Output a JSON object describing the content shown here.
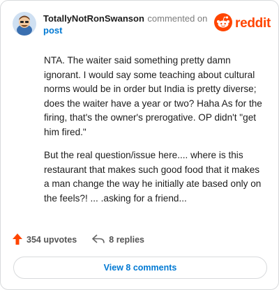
{
  "header": {
    "username": "TotallyNotRonSwanson",
    "commented_text": "commented on",
    "post_link": "post",
    "brand": "reddit"
  },
  "comment": {
    "paragraphs": [
      "NTA. The waiter said something pretty damn ignorant. I would say some teaching about cultural norms would be in order but India is pretty diverse; does the waiter have a year or two? Haha As for the firing, that's the owner's prerogative. OP didn't \"get him fired.\"",
      "But the real question/issue here.... where is this restaurant that makes such good food that it makes a man change the way he initially ate based only on the feels?! ... .asking for a friend..."
    ]
  },
  "actions": {
    "upvotes": "354 upvotes",
    "replies": "8 replies"
  },
  "footer": {
    "view_comments": "View 8 comments"
  },
  "colors": {
    "brand": "#ff4500",
    "link": "#0079d3",
    "upvote": "#ff4500"
  },
  "icons": {
    "avatar": "avatar",
    "logo": "reddit-snoo-icon",
    "upvote": "upvote-arrow-icon",
    "reply": "reply-arrow-icon"
  }
}
